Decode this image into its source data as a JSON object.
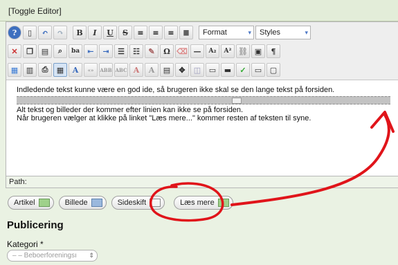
{
  "toggle": {
    "label": "[Toggle Editor]"
  },
  "toolbar": {
    "format_label": "Format",
    "styles_label": "Styles",
    "row1_icons": [
      "help-icon",
      "new-document-icon",
      "undo-icon",
      "redo-icon"
    ],
    "row1_format_icons": [
      "bold-icon",
      "italic-icon",
      "underline-icon",
      "strikethrough-icon",
      "align-left-icon",
      "align-center-icon",
      "align-right-icon",
      "justify-icon"
    ],
    "row2_icons": [
      "cut-icon",
      "copy-icon",
      "paste-icon",
      "find-icon",
      "replace-icon",
      "outdent-icon",
      "indent-icon",
      "bullet-list-icon",
      "numbered-list-icon",
      "cleanup-icon",
      "special-char-icon",
      "eraser-icon",
      "horizontal-rule-icon",
      "subscript-icon",
      "superscript-icon",
      "link-icon",
      "source-icon",
      "paragraph-icon"
    ],
    "row3_icons": [
      "image-icon",
      "media-icon",
      "print-icon",
      "table-icon",
      "spellcheck-icon",
      "abbr-icon",
      "acronym-icon",
      "cite-icon",
      "strike-icon",
      "insert-icon",
      "template-icon",
      "visual-aid-icon",
      "layer-icon",
      "ruler-icon",
      "spell-icon",
      "page-break-icon",
      "readmore-icon"
    ]
  },
  "content": {
    "intro": "Indledende tekst kunne være en god ide, så brugeren ikke skal se den lange tekst på forsiden.",
    "rest_line1": "Alt tekst og billeder der kommer efter linien kan ikke se på forsiden.",
    "rest_line2": "Når brugeren vælger at klikke på linket \"Læs mere...\" kommer resten af teksten til syne."
  },
  "path": {
    "label": "Path:"
  },
  "buttons": {
    "artikel": "Artikel",
    "billede": "Billede",
    "sideskift": "Sideskift",
    "laes_mere": "Læs mere"
  },
  "publishing": {
    "title": "Publicering",
    "category_label": "Kategori *",
    "category_value": "– – Beboerforeningsı"
  },
  "colors": {
    "background": "#eaf2e3",
    "annotation": "#e0141a",
    "accent": "#4d78c6"
  }
}
